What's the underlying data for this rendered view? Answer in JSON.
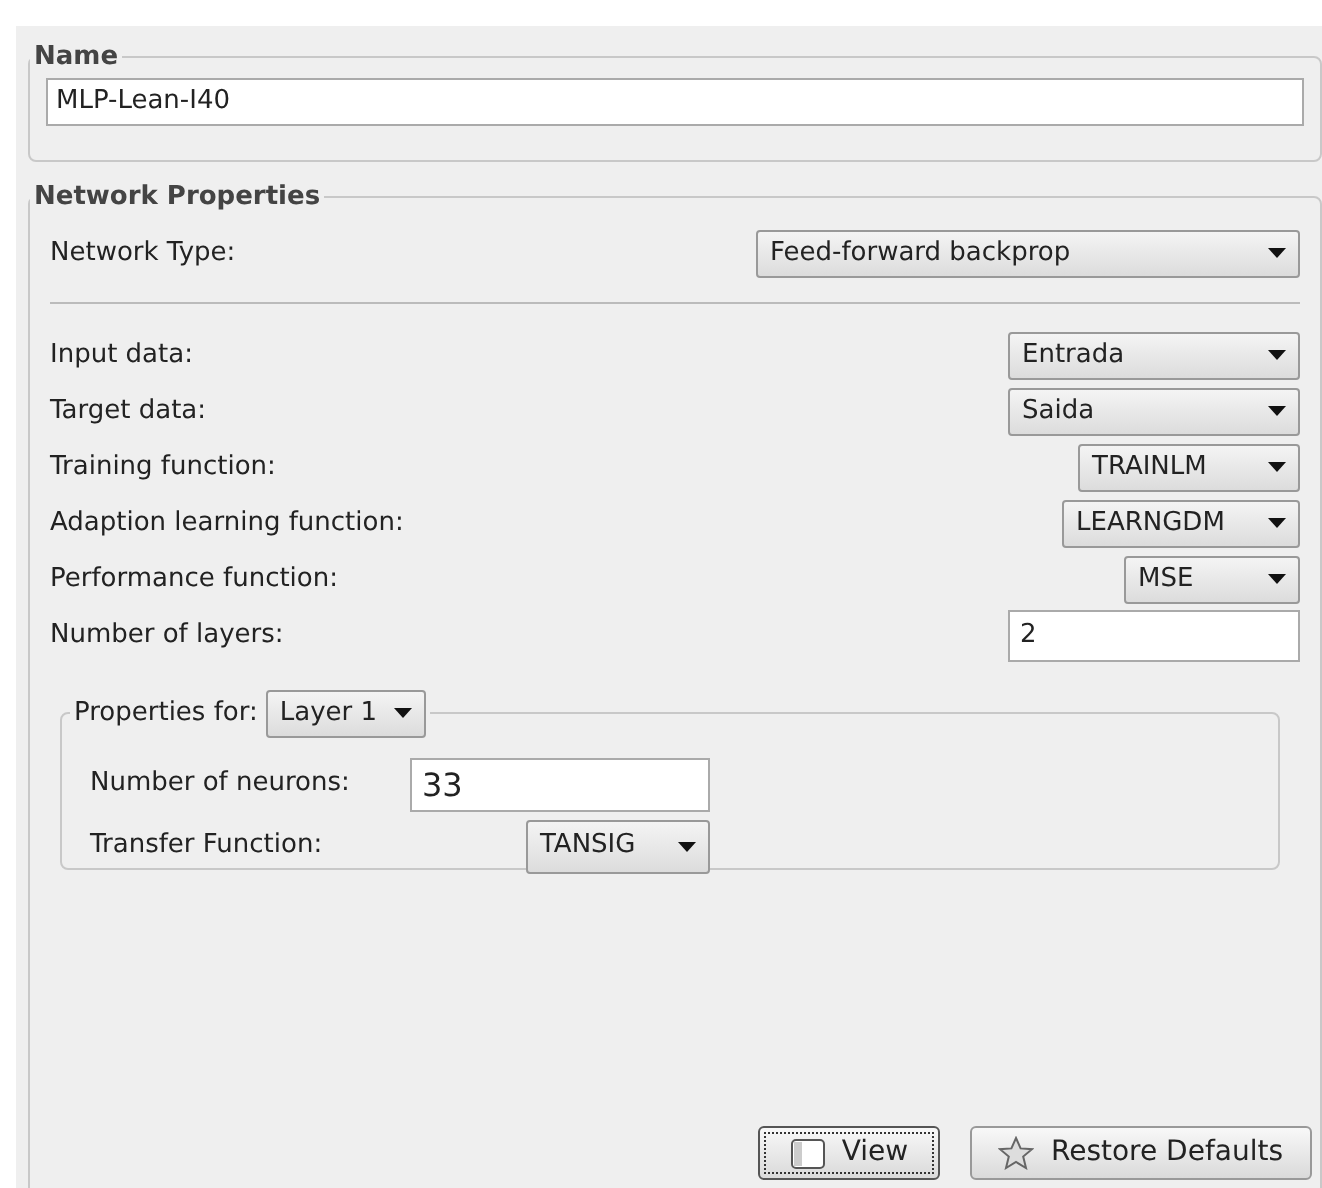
{
  "name_group": {
    "title": "Name",
    "value": "MLP-Lean-I40"
  },
  "network_properties": {
    "title": "Network Properties",
    "network_type": {
      "label": "Network Type:",
      "value": "Feed-forward backprop"
    },
    "rows": [
      {
        "kind": "dropdown",
        "label": "Input data:",
        "value": "Entrada"
      },
      {
        "kind": "dropdown",
        "label": "Target data:",
        "value": "Saida"
      },
      {
        "kind": "dropdown",
        "label": "Training function:",
        "value": "TRAINLM"
      },
      {
        "kind": "dropdown",
        "label": "Adaption learning function:",
        "value": "LEARNGDM"
      },
      {
        "kind": "dropdown",
        "label": "Performance function:",
        "value": "MSE"
      },
      {
        "kind": "text",
        "label": "Number of layers:",
        "value": "2"
      }
    ],
    "layer_properties": {
      "label": "Properties for:",
      "layer": "Layer 1",
      "neurons": {
        "label": "Number of neurons:",
        "value": "33"
      },
      "transfer": {
        "label": "Transfer Function:",
        "value": "TANSIG"
      }
    }
  },
  "buttons": [
    {
      "kind": "view",
      "label": "View",
      "focused": true
    },
    {
      "kind": "restore",
      "label": "Restore Defaults",
      "focused": false
    }
  ]
}
